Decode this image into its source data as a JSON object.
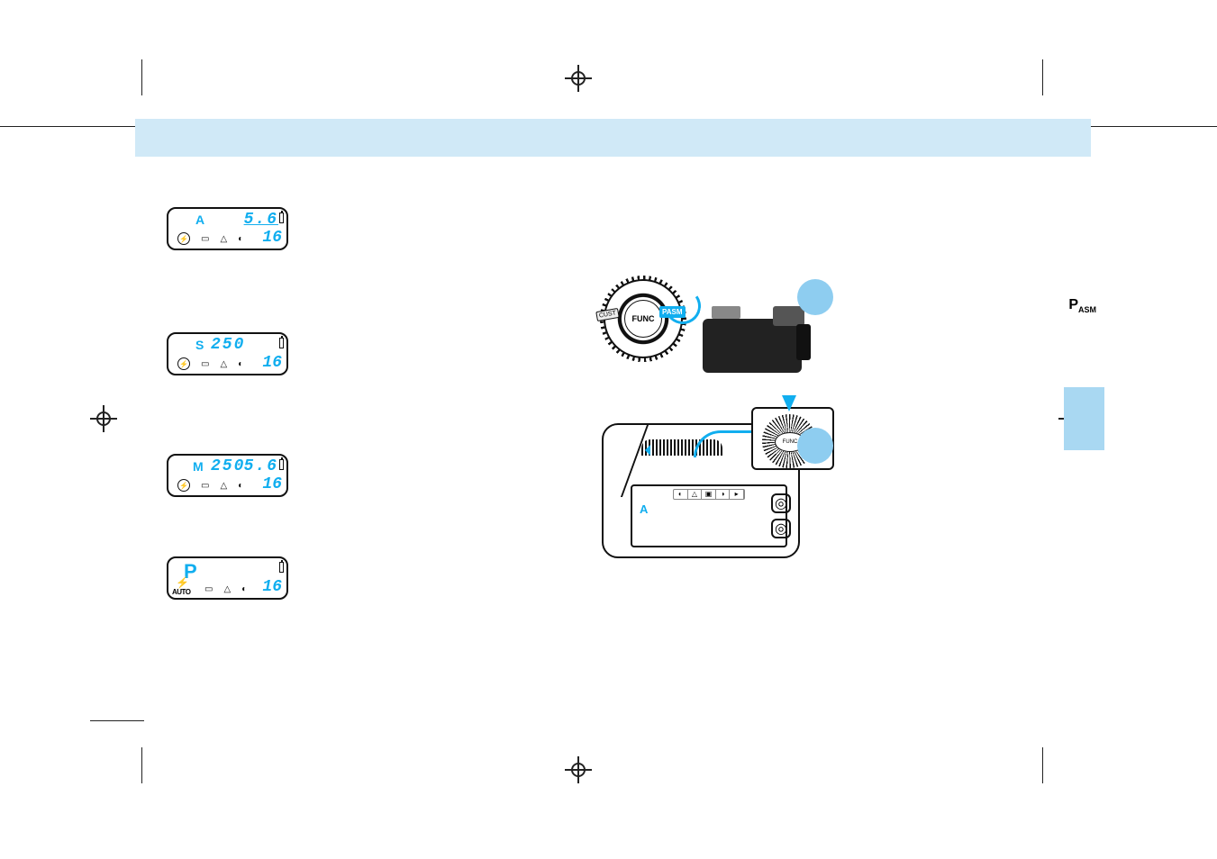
{
  "header_band": "",
  "margin_label": {
    "p": "P",
    "sub": "ASM"
  },
  "dial_labels": {
    "center": "FUNC",
    "mode": "PASM",
    "cust": "CUST"
  },
  "lcd": [
    {
      "mode": "A",
      "shutter": "",
      "aperture": "5.6",
      "count": "16"
    },
    {
      "mode": "S",
      "shutter": "250",
      "aperture": "",
      "count": "16"
    },
    {
      "mode": "M",
      "shutter": "250",
      "aperture": "5.6",
      "count": "16"
    },
    {
      "mode": "P",
      "shutter": "",
      "aperture": "",
      "count": "16",
      "flash_auto_label": "AUTO"
    }
  ],
  "figure2": {
    "lcd_mode_letter": "A"
  }
}
